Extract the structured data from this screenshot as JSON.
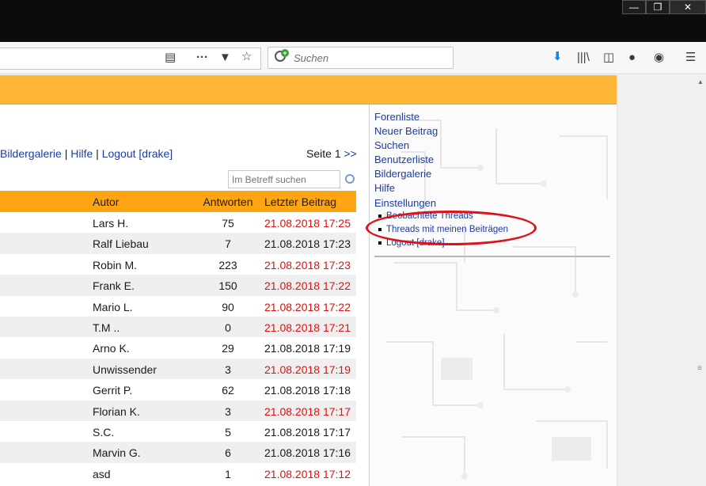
{
  "browser": {
    "search_placeholder": "Suchen",
    "window_buttons": [
      "—",
      "❐",
      "✕"
    ],
    "toolbar_icons": [
      "reader-view-icon",
      "more-icon",
      "pocket-icon",
      "bookmark-star-icon",
      "downloads-icon",
      "library-icon",
      "sidebar-icon",
      "extensions-icon",
      "account-icon",
      "menu-icon"
    ]
  },
  "navline": {
    "links": [
      "Bildergalerie",
      "Hilfe",
      "Logout [drake]"
    ],
    "separator": "|"
  },
  "pager": {
    "label": "Seite",
    "current": "1",
    "next": ">>"
  },
  "search": {
    "placeholder": "Im Betreff suchen"
  },
  "table": {
    "headers": {
      "autor": "Autor",
      "antworten": "Antworten",
      "letzter": "Letzter Beitrag"
    },
    "rows": [
      {
        "autor": "Lars H.",
        "antworten": "75",
        "date": "21.08.2018 17:25",
        "red": true
      },
      {
        "autor": "Ralf Liebau",
        "antworten": "7",
        "date": "21.08.2018 17:23",
        "red": false
      },
      {
        "autor": "Robin M.",
        "antworten": "223",
        "date": "21.08.2018 17:23",
        "red": true
      },
      {
        "autor": "Frank E.",
        "antworten": "150",
        "date": "21.08.2018 17:22",
        "red": true
      },
      {
        "autor": "Mario L.",
        "antworten": "90",
        "date": "21.08.2018 17:22",
        "red": true
      },
      {
        "autor": "T.M ..",
        "antworten": "0",
        "date": "21.08.2018 17:21",
        "red": true
      },
      {
        "autor": "Arno K.",
        "antworten": "29",
        "date": "21.08.2018 17:19",
        "red": false
      },
      {
        "autor": "Unwissender",
        "antworten": "3",
        "date": "21.08.2018 17:19",
        "red": true
      },
      {
        "autor": "Gerrit P.",
        "antworten": "62",
        "date": "21.08.2018 17:18",
        "red": false
      },
      {
        "autor": "Florian K.",
        "antworten": "3",
        "date": "21.08.2018 17:17",
        "red": true
      },
      {
        "autor": "S.C.",
        "antworten": "5",
        "date": "21.08.2018 17:17",
        "red": false
      },
      {
        "autor": "Marvin G.",
        "antworten": "6",
        "date": "21.08.2018 17:16",
        "red": false
      },
      {
        "autor": "asd",
        "antworten": "1",
        "date": "21.08.2018 17:12",
        "red": true
      }
    ]
  },
  "sidebar": {
    "menu": [
      "Forenliste",
      "Neuer Beitrag",
      "Suchen",
      "Benutzerliste",
      "Bildergalerie",
      "Hilfe",
      "Einstellungen"
    ],
    "submenu": [
      "Beobachtete Threads",
      "Threads mit meinen Beiträgen",
      "Logout [drake]"
    ]
  },
  "colors": {
    "banner": "#ffb535",
    "header": "#ffa514",
    "link": "#1a3ca8",
    "highlight": "#e01010"
  }
}
